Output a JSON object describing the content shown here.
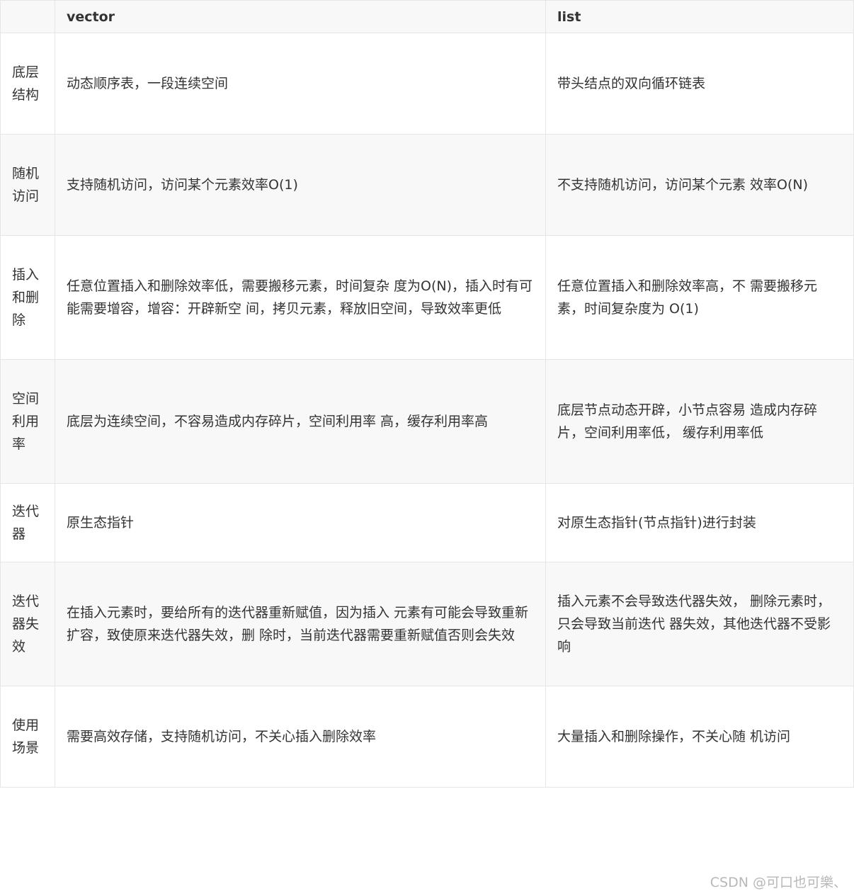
{
  "table": {
    "headers": [
      "",
      "vector",
      "list"
    ],
    "rows": [
      {
        "label": "底层结构",
        "vector": "动态顺序表，一段连续空间",
        "list": "带头结点的双向循环链表"
      },
      {
        "label": "随机访问",
        "vector": "支持随机访问，访问某个元素效率O(1)",
        "list": "不支持随机访问，访问某个元素 效率O(N)"
      },
      {
        "label": "插入和删除",
        "vector": "任意位置插入和删除效率低，需要搬移元素，时间复杂 度为O(N)，插入时有可能需要增容，增容：开辟新空 间，拷贝元素，释放旧空间，导致效率更低",
        "list": "任意位置插入和删除效率高，不 需要搬移元素，时间复杂度为 O(1)"
      },
      {
        "label": "空间利用率",
        "vector": "底层为连续空间，不容易造成内存碎片，空间利用率 高，缓存利用率高",
        "list": "底层节点动态开辟，小节点容易 造成内存碎片，空间利用率低， 缓存利用率低"
      },
      {
        "label": "迭代器",
        "vector": "原生态指针",
        "list": "对原生态指针(节点指针)进行封装"
      },
      {
        "label": "迭代器失效",
        "vector": "在插入元素时，要给所有的迭代器重新赋值，因为插入 元素有可能会导致重新扩容，致使原来迭代器失效，删 除时，当前迭代器需要重新赋值否则会失效",
        "list": "插入元素不会导致迭代器失效， 删除元素时，只会导致当前迭代 器失效，其他迭代器不受影响"
      },
      {
        "label": "使用场景",
        "vector": "需要高效存储，支持随机访问，不关心插入删除效率",
        "list": "大量插入和删除操作，不关心随 机访问"
      }
    ]
  },
  "watermark": "CSDN @可口也可樂、"
}
